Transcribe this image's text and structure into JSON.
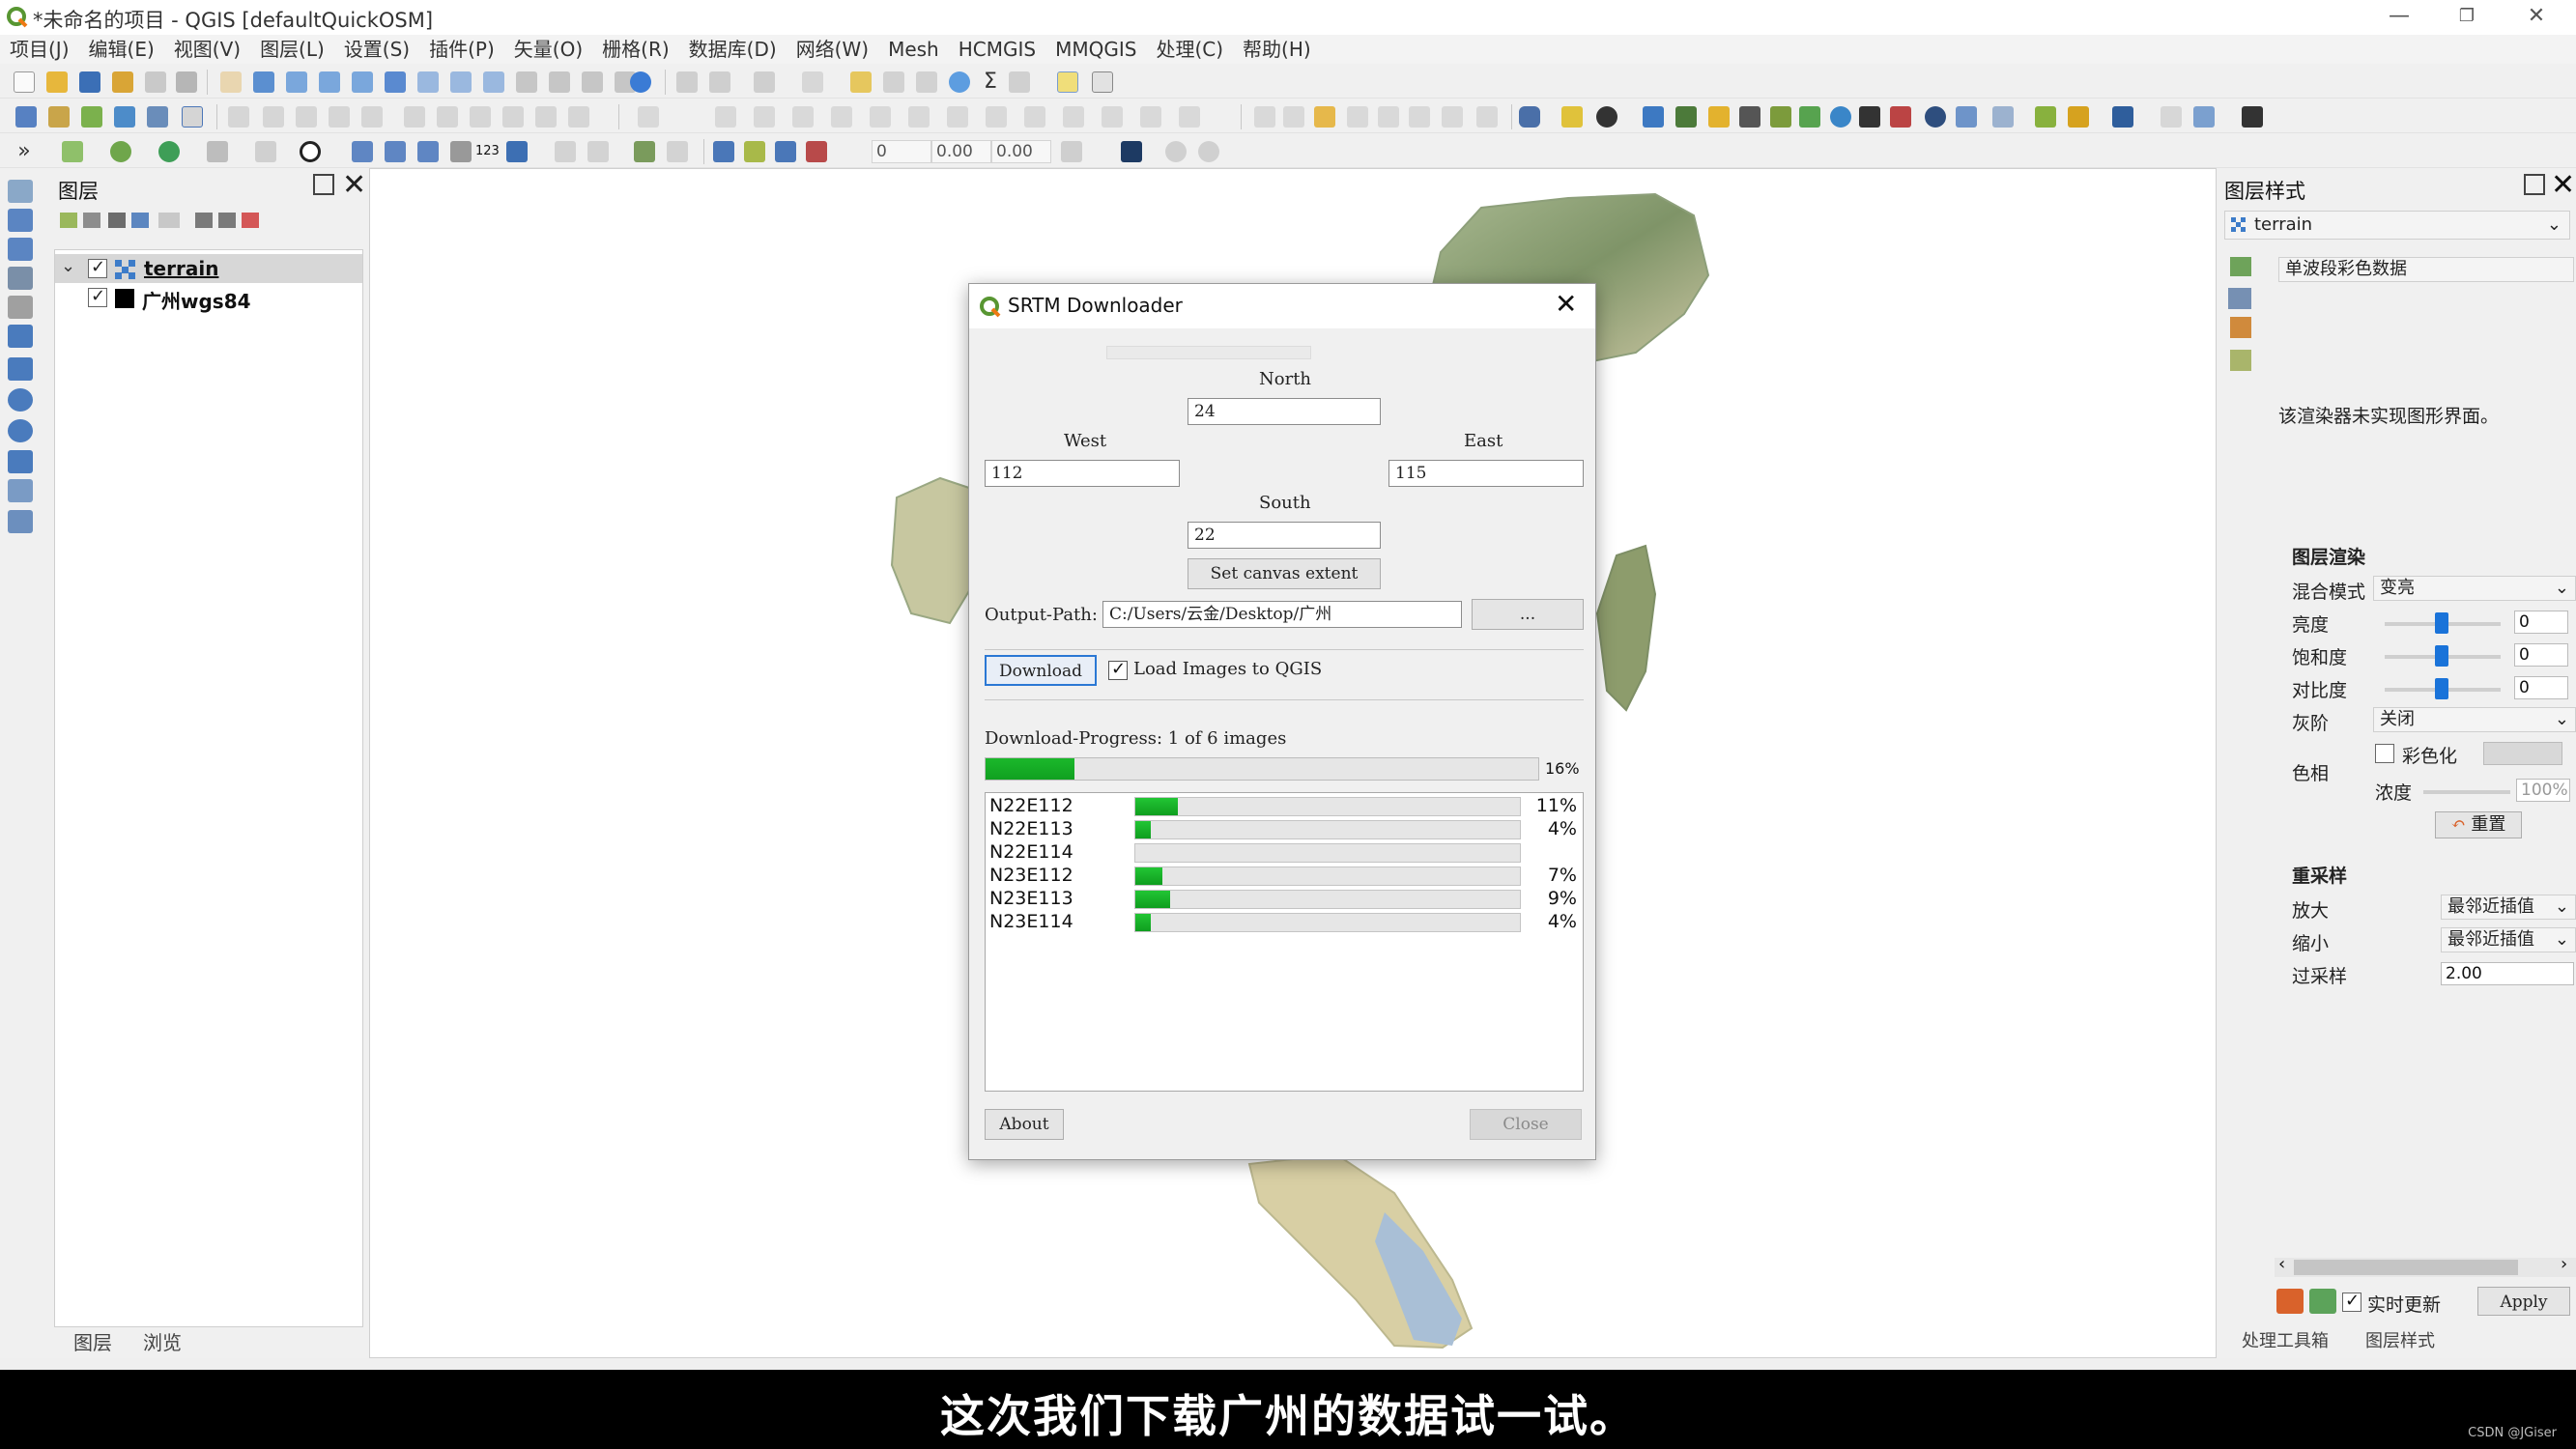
{
  "window": {
    "title": "*未命名的项目 - QGIS [defaultQuickOSM]",
    "minimize": "—",
    "restore": "❐",
    "close": "✕"
  },
  "menu": [
    "项目(J)",
    "编辑(E)",
    "视图(V)",
    "图层(L)",
    "设置(S)",
    "插件(P)",
    "矢量(O)",
    "栅格(R)",
    "数据库(D)",
    "网络(W)",
    "Mesh",
    "HCMGIS",
    "MMQGIS",
    "处理(C)",
    "帮助(H)"
  ],
  "toolbar3": {
    "field1": "0",
    "field2": "0.00",
    "field3": "0.00"
  },
  "layers_panel": {
    "title": "图层",
    "items": [
      {
        "name": "terrain",
        "checked": true,
        "selected": true
      },
      {
        "name": "广州wgs84",
        "checked": true,
        "selected": false
      }
    ],
    "tabs": [
      "图层",
      "浏览"
    ]
  },
  "dialog": {
    "title": "SRTM Downloader",
    "north_label": "North",
    "north_value": "24",
    "west_label": "West",
    "west_value": "112",
    "east_label": "East",
    "east_value": "115",
    "south_label": "South",
    "south_value": "22",
    "canvas_extent_btn": "Set canvas extent",
    "output_label": "Output-Path:",
    "output_value": "C:/Users/云金/Desktop/广州",
    "browse_btn": "...",
    "download_btn": "Download",
    "load_label": "Load Images to QGIS",
    "load_checked": true,
    "progress_label": "Download-Progress: 1 of 6 images",
    "overall_percent": "16%",
    "overall_fraction": 0.16,
    "tiles": [
      {
        "name": "N22E112",
        "percent": "11%",
        "fraction": 0.11
      },
      {
        "name": "N22E113",
        "percent": "4%",
        "fraction": 0.04
      },
      {
        "name": "N22E114",
        "percent": "",
        "fraction": 0
      },
      {
        "name": "N23E112",
        "percent": "7%",
        "fraction": 0.07
      },
      {
        "name": "N23E113",
        "percent": "9%",
        "fraction": 0.09
      },
      {
        "name": "N23E114",
        "percent": "4%",
        "fraction": 0.04
      }
    ],
    "about_btn": "About",
    "close_btn": "Close"
  },
  "style_panel": {
    "title": "图层样式",
    "layer": "terrain",
    "renderer": "单波段彩色数据",
    "message": "该渲染器未实现图形界面。",
    "render_section": "图层渲染",
    "blend_label": "混合模式",
    "blend_value": "变亮",
    "brightness_label": "亮度",
    "brightness_value": "0",
    "saturation_label": "饱和度",
    "saturation_value": "0",
    "contrast_label": "对比度",
    "contrast_value": "0",
    "gray_label": "灰阶",
    "gray_value": "关闭",
    "hue_label": "色相",
    "colorize_label": "彩色化",
    "strength_label": "浓度",
    "strength_value": "100%",
    "reset_btn": "重置",
    "resample_section": "重采样",
    "zoomin_label": "放大",
    "zoomin_value": "最邻近插值",
    "zoomout_label": "缩小",
    "zoomout_value": "最邻近插值",
    "oversample_label": "过采样",
    "oversample_value": "2.00",
    "live_update_label": "实时更新",
    "apply_btn": "Apply",
    "bottom_tabs": [
      "处理工具箱",
      "图层样式"
    ]
  },
  "subtitle": "这次我们下载广州的数据试一试。",
  "watermark": "CSDN @JGiser",
  "colors": {
    "progress_green": "#10a020",
    "accent_blue": "#1a73d9",
    "map_green": "#8a9e72",
    "water": "#a9bfd6"
  }
}
